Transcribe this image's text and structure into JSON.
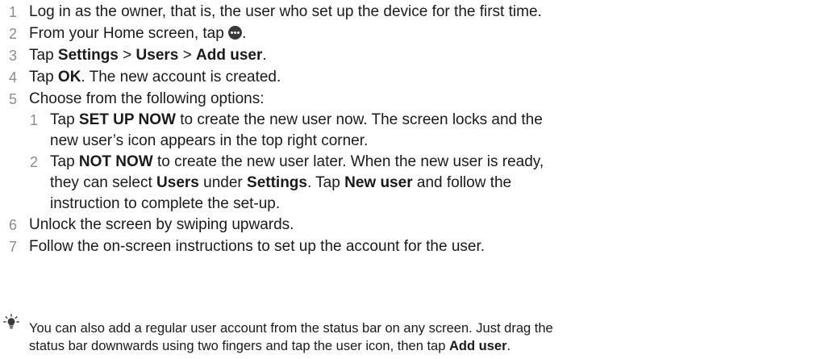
{
  "steps": [
    {
      "num": "1",
      "parts": [
        "Log in as the owner, that is, the user who set up the device for the first time."
      ]
    },
    {
      "num": "2",
      "prefix": "From your Home screen, tap ",
      "icon": "more-apps-icon",
      "suffix": "."
    },
    {
      "num": "3",
      "t1": "Tap ",
      "b1": "Settings",
      "t2": " > ",
      "b2": "Users",
      "t3": " > ",
      "b3": "Add user",
      "t4": "."
    },
    {
      "num": "4",
      "t1": "Tap ",
      "b1": "OK",
      "t2": ". The new account is created."
    },
    {
      "num": "5",
      "t1": "Choose from the following options:"
    },
    {
      "num": "6",
      "t1": "Unlock the screen by swiping upwards."
    },
    {
      "num": "7",
      "t1": "Follow the on-screen instructions to set up the account for the user."
    }
  ],
  "substeps": [
    {
      "num": "1",
      "l1_t1": "Tap ",
      "l1_b1": "SET UP NOW",
      "l1_t2": " to create the new user now. The screen locks and the",
      "l2_t1": "new user’s icon appears in the top right corner."
    },
    {
      "num": "2",
      "l1_t1": "Tap ",
      "l1_b1": "NOT NOW",
      "l1_t2": " to create the new user later. When the new user is ready,",
      "l2_t1": "they can select ",
      "l2_b1": "Users",
      "l2_t2": " under ",
      "l2_b2": "Settings",
      "l2_t3": ". Tap ",
      "l2_b3": "New user",
      "l2_t4": " and follow the",
      "l3_t1": "instruction to complete the set-up."
    }
  ],
  "tip": {
    "icon": "lightbulb-tip-icon",
    "l1": "You can also add a regular user account from the status bar on any screen. Just drag the",
    "l2_t1": "status bar downwards using two fingers and tap the user icon, then tap ",
    "l2_b1": "Add user",
    "l2_t2": "."
  }
}
